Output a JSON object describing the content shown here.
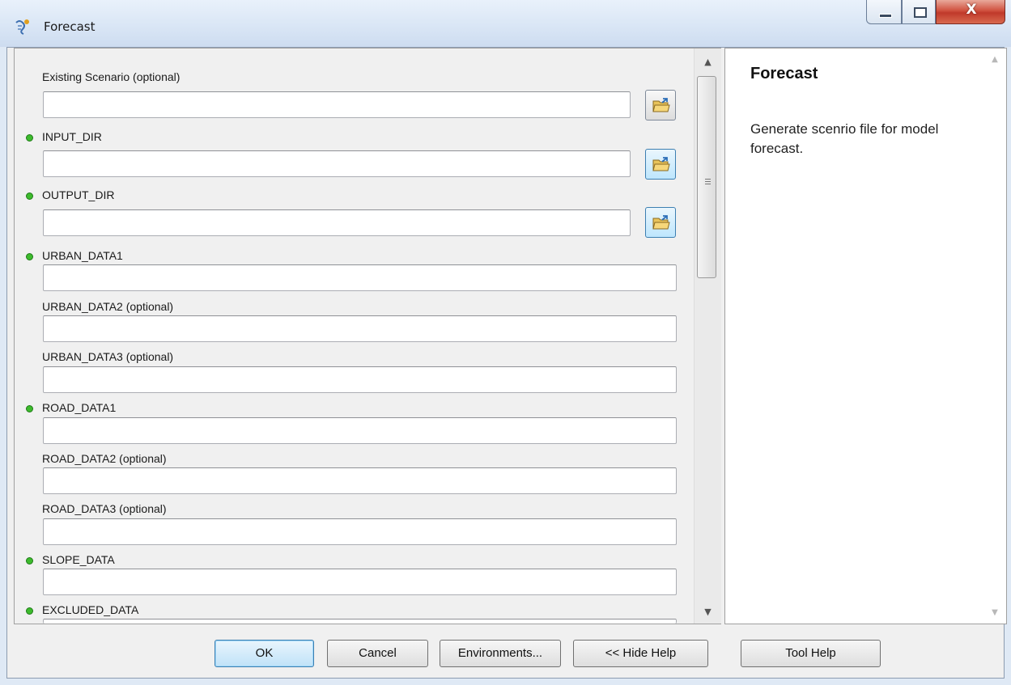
{
  "window": {
    "title": "Forecast",
    "controls": {
      "minimize": "minimize",
      "maximize": "maximize",
      "close": "X"
    }
  },
  "form": {
    "fields": [
      {
        "label": "Existing Scenario (optional)",
        "required": false,
        "value": "",
        "has_browse": true
      },
      {
        "label": "INPUT_DIR",
        "required": true,
        "value": "",
        "has_browse": true
      },
      {
        "label": "OUTPUT_DIR",
        "required": true,
        "value": "",
        "has_browse": true
      },
      {
        "label": "URBAN_DATA1",
        "required": true,
        "value": "",
        "has_browse": false
      },
      {
        "label": "URBAN_DATA2 (optional)",
        "required": false,
        "value": "",
        "has_browse": false
      },
      {
        "label": "URBAN_DATA3 (optional)",
        "required": false,
        "value": "",
        "has_browse": false
      },
      {
        "label": "ROAD_DATA1",
        "required": true,
        "value": "",
        "has_browse": false
      },
      {
        "label": "ROAD_DATA2 (optional)",
        "required": false,
        "value": "",
        "has_browse": false
      },
      {
        "label": "ROAD_DATA3 (optional)",
        "required": false,
        "value": "",
        "has_browse": false
      },
      {
        "label": "SLOPE_DATA",
        "required": true,
        "value": "",
        "has_browse": false
      },
      {
        "label": "EXCLUDED_DATA",
        "required": true,
        "value": "",
        "has_browse": false
      }
    ]
  },
  "help": {
    "title": "Forecast",
    "text": "Generate scenrio file for model forecast."
  },
  "buttons": {
    "ok": "OK",
    "cancel": "Cancel",
    "environments": "Environments...",
    "hide_help": "<< Hide Help",
    "tool_help": "Tool Help"
  },
  "colors": {
    "required_dot": "#3dbb2d",
    "default_button_border": "#3c7fb1",
    "close_button": "#c0392b"
  },
  "icons": {
    "app": "script-tool-icon",
    "browse": "open-folder-icon"
  }
}
